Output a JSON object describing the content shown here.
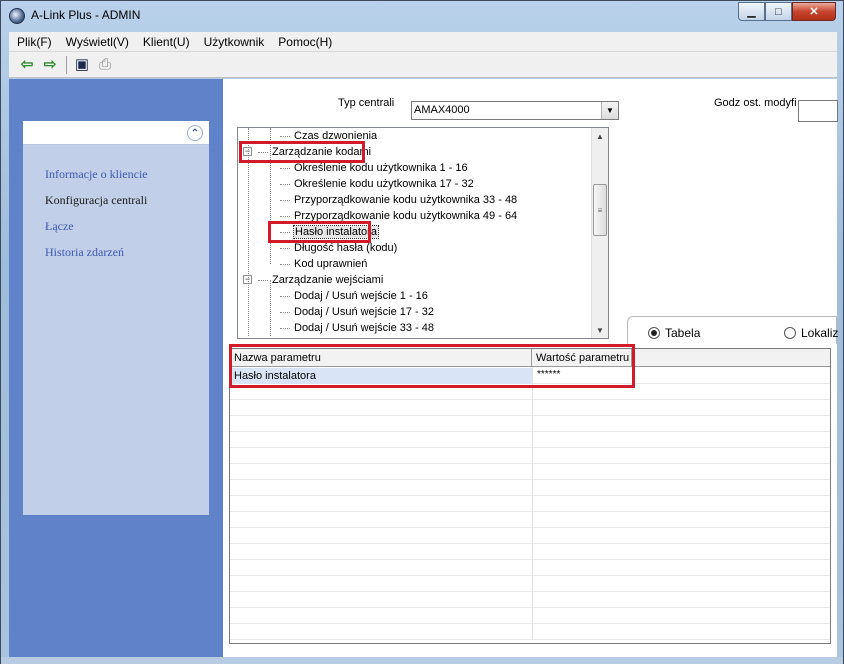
{
  "window": {
    "title": "A-Link Plus - ADMIN"
  },
  "menu": [
    "Plik(F)",
    "Wyświetl(V)",
    "Klient(U)",
    "Użytkownik",
    "Pomoc(H)"
  ],
  "toolbar": {
    "icons": [
      "back-icon",
      "forward-icon",
      "save-icon",
      "print-icon"
    ],
    "back_glyph": "⇦",
    "forward_glyph": "⇨",
    "save_glyph": "▣",
    "print_glyph": "⎙"
  },
  "sidebar": {
    "collapse_glyph": "⌃",
    "items": [
      "Informacje o kliencie",
      "Konfiguracja centrali",
      "Łącze",
      "Historia zdarzeń"
    ]
  },
  "main": {
    "typ_label": "Typ centrali",
    "typ_value": "AMAX4000",
    "godz_label": "Godz ost. modyfi"
  },
  "tree": {
    "items": [
      {
        "label": "Czas dzwonienia",
        "level": 2
      },
      {
        "label": "Zarządzanie kodami",
        "level": 1,
        "expander": "−"
      },
      {
        "label": "Określenie kodu użytkownika 1 - 16",
        "level": 2
      },
      {
        "label": "Określenie kodu użytkownika 17 - 32",
        "level": 2
      },
      {
        "label": "Przyporządkowanie kodu użytkownika 33 - 48",
        "level": 2
      },
      {
        "label": "Przyporządkowanie kodu użytkownika 49 - 64",
        "level": 2
      },
      {
        "label": "Hasło instalatora",
        "level": 2,
        "selected": true
      },
      {
        "label": "Długość hasła (kodu)",
        "level": 2
      },
      {
        "label": "Kod uprawnień",
        "level": 2
      },
      {
        "label": "Zarządzanie wejściami",
        "level": 1,
        "expander": "−"
      },
      {
        "label": "Dodaj / Usuń wejście 1 - 16",
        "level": 2
      },
      {
        "label": "Dodaj / Usuń wejście 17 - 32",
        "level": 2
      },
      {
        "label": "Dodaj / Usuń wejście 33 - 48",
        "level": 2
      }
    ]
  },
  "view_tabs": {
    "tabela": "Tabela",
    "lokal": "Lokaliz"
  },
  "grid": {
    "headers": [
      "Nazwa parametru",
      "Wartość parametru"
    ],
    "rows": [
      {
        "name": "Hasło instalatora",
        "value": "******"
      }
    ]
  },
  "colors": {
    "highlight": "#d21a2a",
    "sidebar": "#5f82c9",
    "panel": "#c2cfe8"
  }
}
